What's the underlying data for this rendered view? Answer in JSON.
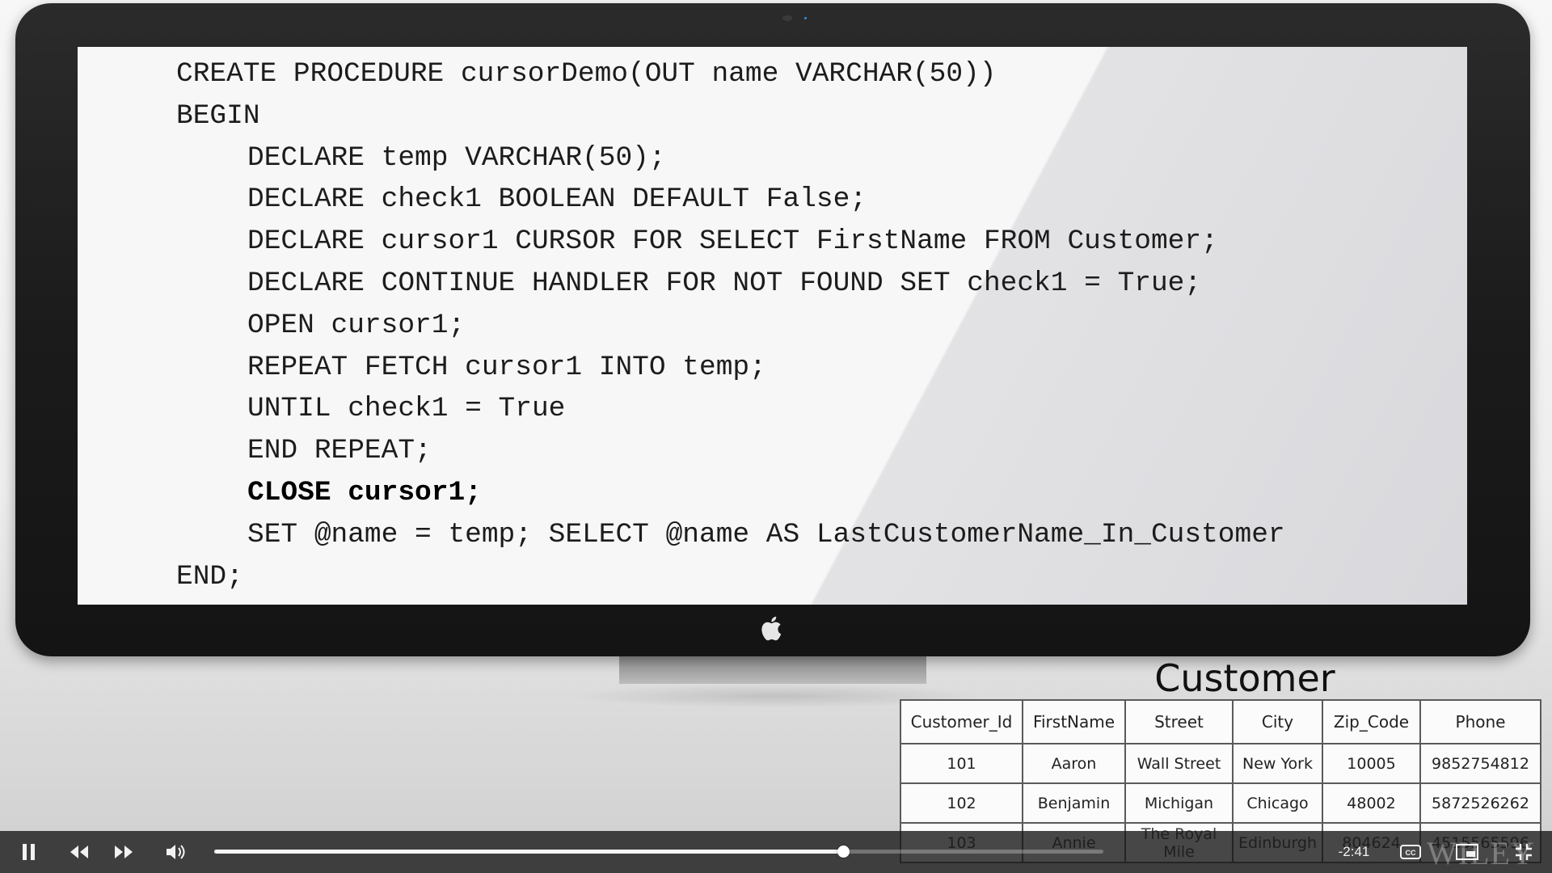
{
  "code_lines": [
    {
      "text": "CREATE PROCEDURE cursorDemo(OUT name VARCHAR(50))",
      "indent": 0,
      "bold": false
    },
    {
      "text": "BEGIN",
      "indent": 0,
      "bold": false
    },
    {
      "text": "DECLARE temp VARCHAR(50);",
      "indent": 1,
      "bold": false
    },
    {
      "text": "DECLARE check1 BOOLEAN DEFAULT False;",
      "indent": 1,
      "bold": false
    },
    {
      "text": "DECLARE cursor1 CURSOR FOR SELECT FirstName FROM Customer;",
      "indent": 1,
      "bold": false
    },
    {
      "text": "DECLARE CONTINUE HANDLER FOR NOT FOUND SET check1 = True;",
      "indent": 1,
      "bold": false
    },
    {
      "text": "OPEN cursor1;",
      "indent": 1,
      "bold": false
    },
    {
      "text": "REPEAT FETCH cursor1 INTO temp;",
      "indent": 1,
      "bold": false
    },
    {
      "text": "UNTIL check1 = True",
      "indent": 1,
      "bold": false
    },
    {
      "text": "END REPEAT;",
      "indent": 1,
      "bold": false
    },
    {
      "text": "CLOSE cursor1;",
      "indent": 1,
      "bold": true
    },
    {
      "text": "SET @name = temp; SELECT @name AS LastCustomerName_In_Customer",
      "indent": 1,
      "bold": false
    },
    {
      "text": "END;",
      "indent": 0,
      "bold": false
    }
  ],
  "customer_table": {
    "title": "Customer",
    "columns": [
      "Customer_Id",
      "FirstName",
      "Street",
      "City",
      "Zip_Code",
      "Phone"
    ],
    "rows": [
      [
        "101",
        "Aaron",
        "Wall Street",
        "New York",
        "10005",
        "9852754812"
      ],
      [
        "102",
        "Benjamin",
        "Michigan",
        "Chicago",
        "48002",
        "5872526262"
      ],
      [
        "103",
        "Annie",
        "The Royal Mile",
        "Edinburgh",
        "804624",
        "4515565596"
      ]
    ]
  },
  "player": {
    "time_remaining": "-2:41",
    "progress_fraction": 0.707,
    "icons": {
      "pause": "pause-icon",
      "rewind": "rewind-icon",
      "forward": "fast-forward-icon",
      "volume": "volume-icon",
      "captions": "closed-captions-icon",
      "pip": "picture-in-picture-icon",
      "fullscreen": "fullscreen-exit-icon"
    },
    "watermark": "WILEY"
  },
  "colors": {
    "screen_bg": "#f7f7f7",
    "bezel": "#1b1b1b",
    "player_bar": "#141416"
  }
}
